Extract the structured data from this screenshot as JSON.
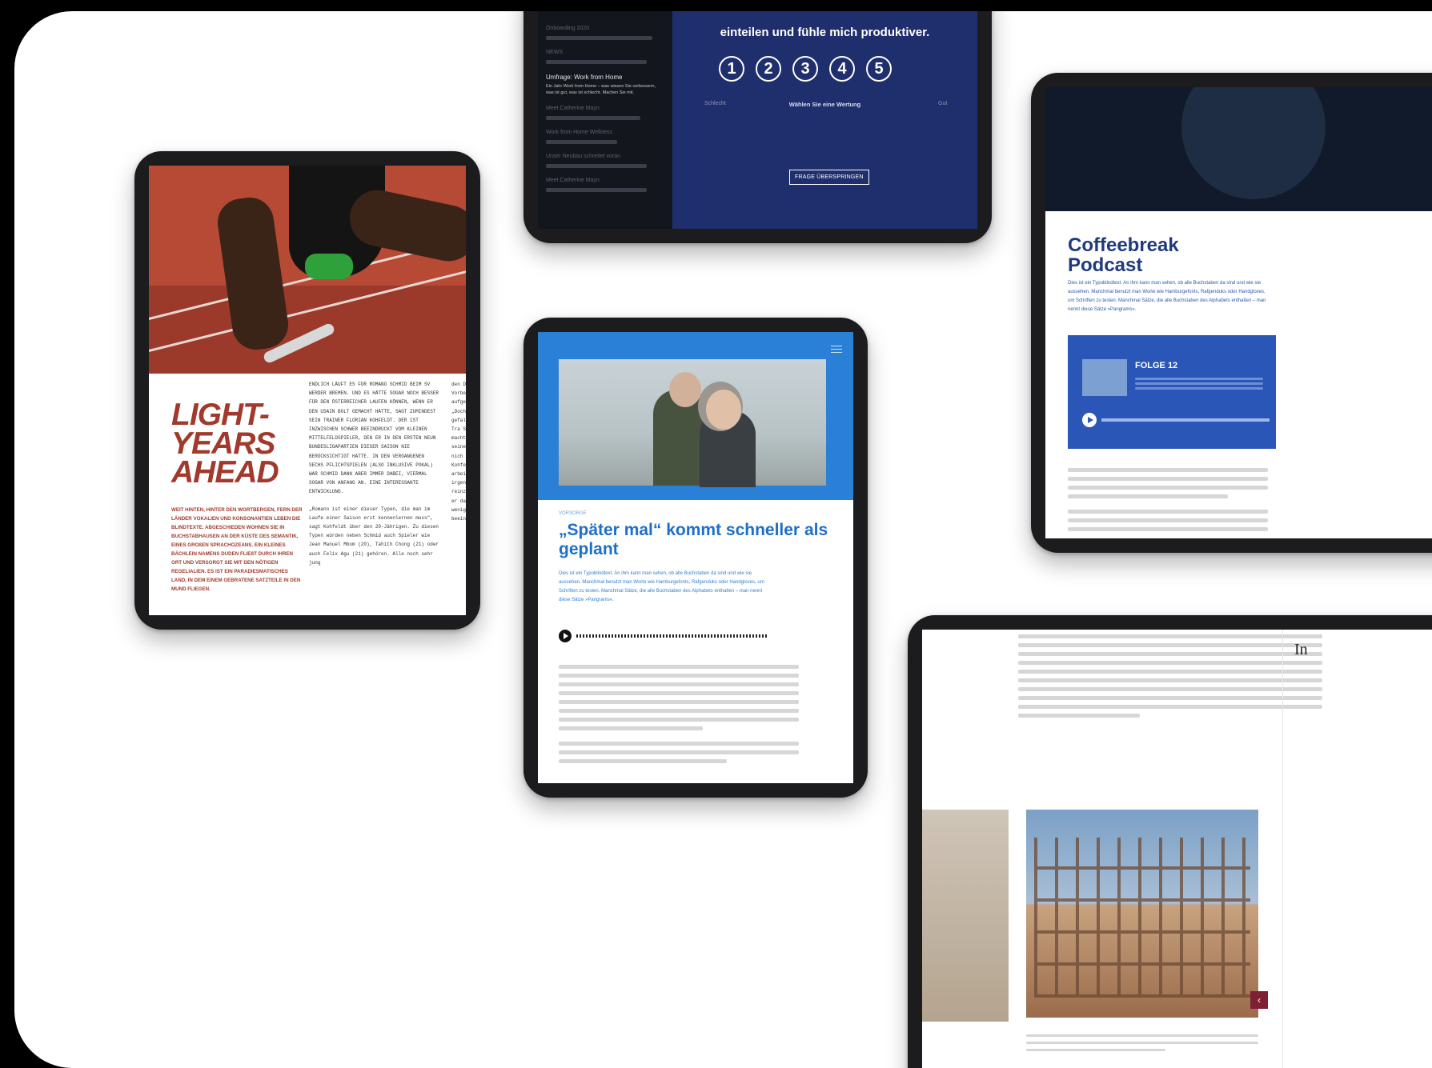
{
  "tablet1": {
    "headline": "LIGHT-YEARS AHEAD",
    "lede": "WEIT HINTEN, HINTER DEN WORTBERGEN, FERN DER LÄNDER VOKALIEN UND KONSONANTIEN LEBEN DIE BLINDTEXTE. ABGESCHIEDEN WOHNEN SIE IN BUCHSTABHAUSEN AN DER KÜSTE DES SEMANTIK, EINES GROßEN SPRACHOZEANS. EIN KLEINES BÄCHLEIN NAMENS DUDEN FLIEßT DURCH IHREN ORT UND VERSORGT SIE MIT DEN NÖTIGEN REGELIALIEN. ES IST EIN PARADIESMATISCHES LAND, IN DEM EINEM GEBRATENE SATZTEILE IN DEN MUND FLIEGEN.",
    "col1": "ENDLICH LÄUFT ES FÜR ROMANO SCHMID BEIM SV WERDER BREMEN. UND ES HÄTTE SOGAR NOCH BESSER FÜR DEN ÖSTERREICHER LAUFEN KÖNNEN, WENN ER DEN USAIN BOLT GEMACHT HÄTTE, SAGT ZUMINDEST SEIN TRAINER FLORIAN KOHFELDT. DER IST INZWISCHEN SCHWER BEEINDRUCKT VOM KLEINEN MITTELFELDSPIELER, DEN ER IN DEN ERSTEN NEUN BUNDESLIGAPARTIEN DIESER SAISON NIE BERÜCKSICHTIGT HATTE. IN DEN VERGANGENEN SECHS PFLICHTSPIELEN (ALSO INKLUSIVE POKAL) WAR SCHMID DANN ABER IMMER DABEI, VIERMAL SOGAR VON ANFANG AN. EINE INTERESSANTE ENTWICKLUNG.",
    "col1b": "„Romano ist einer dieser Typen, die man im Laufe einer Saison erst kennenlernen muss\", sagt Kohfeldt über den 20-Jährigen. Zu diesen Typen würden neben Schmid auch Spieler wie Jean Manuel Mbom (20), Tahith Chong (21) oder auch Felix Agu (21) gehören. Alle noch sehr jung",
    "col2": "den D hatte Vorber aufgef „Doch gefall Je Tra Schmid machte seinen – nich viel a Kohfel arbeit irgend reinzu ist er daraus wenig beeind"
  },
  "tablet2": {
    "sidebar": [
      {
        "title": "Onboarding 2020",
        "active": false
      },
      {
        "title": "NEWS",
        "active": false
      },
      {
        "title": "Umfrage: Work from Home",
        "active": true,
        "sub": "Ein Jahr Work from Home – was wissen Sie verbessern, was ist gut, was ist schlecht. Machen Sie mit."
      },
      {
        "title": "Meet Catherine Mayn",
        "active": false
      },
      {
        "title": "Work from Home Wellness",
        "active": false
      },
      {
        "title": "Unser Neubau schreitet voran",
        "active": false
      },
      {
        "title": "Meet Catherine Mayn",
        "active": false
      }
    ],
    "question": "einteilen und fühle mich produktiver.",
    "ratings": [
      "1",
      "2",
      "3",
      "4",
      "5"
    ],
    "low_label": "Schlecht",
    "hint": "Wählen Sie eine Wertung",
    "high_label": "Gut",
    "skip_label": "FRAGE ÜBERSPRINGEN"
  },
  "tablet3": {
    "title_line1": "Coffeebreak",
    "title_line2": "Podcast",
    "intro": "Dies ist ein Typoblindtext. An ihm kann man sehen, ob alle Buchstaben da sind und wie sie aussehen. Manchmal benutzt man Worte wie Hamburgefonts, Rafgenduks oder Handgloves, um Schriften zu testen. Manchmal Sätze, die alle Buchstaben des Alphabets enthalten – man nennt diese Sätze »Pangrams«.",
    "episode": "FOLGE 12"
  },
  "tablet4": {
    "kicker": "VORSORGE",
    "title": "„Später mal“ kommt schneller als geplant",
    "lead": "Dies ist ein Typoblindtext. An ihm kann man sehen, ob alle Buchstaben da sind und wie sie aussehen. Manchmal benutzt man Worte wie Hamburgefonts, Rafgenduks oder Handgloves, um Schriften zu testen. Manchmal Sätze, die alle Buchstaben des Alphabets enthalten – man nennt diese Sätze »Pangrams«."
  },
  "tablet5": {
    "sidebar_heading": "In"
  }
}
